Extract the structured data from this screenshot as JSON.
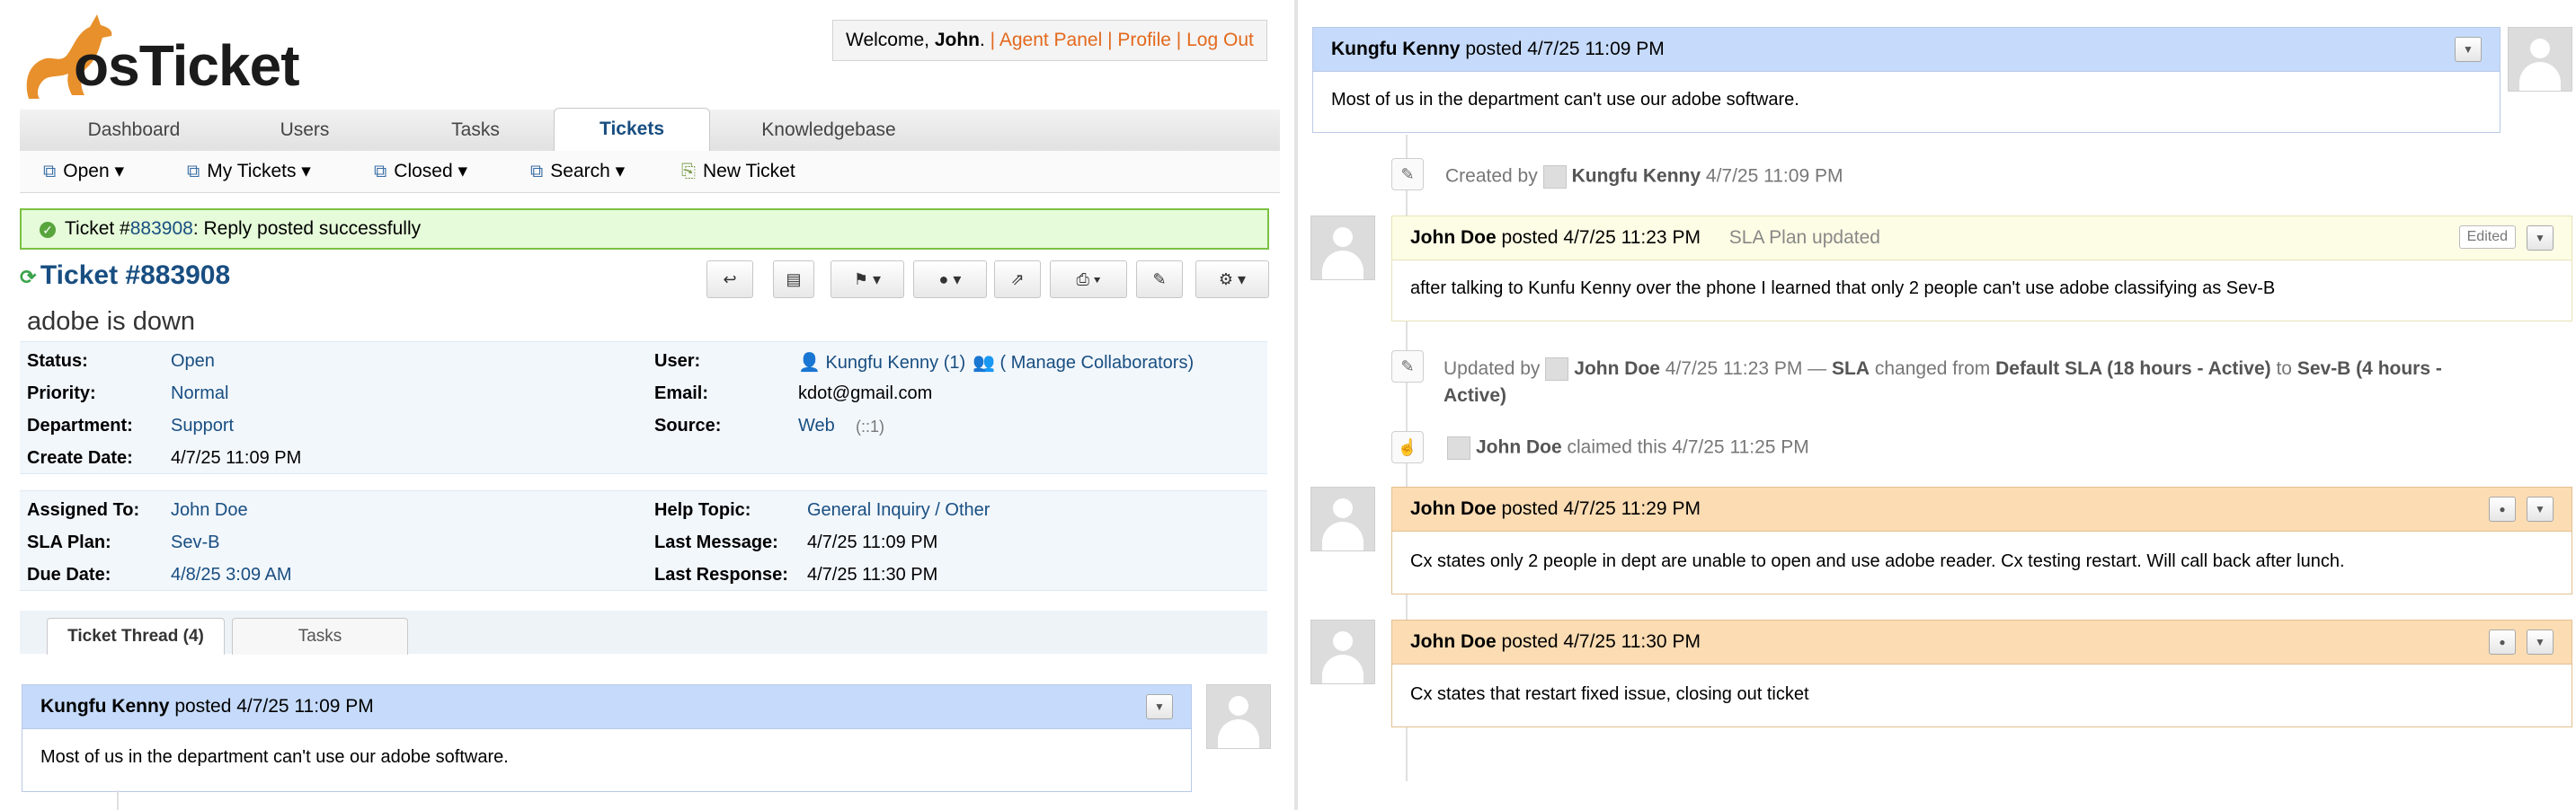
{
  "header": {
    "logo_text": "osTicket",
    "welcome_prefix": "Welcome, ",
    "welcome_name": "John",
    "welcome_suffix": ".",
    "agent_panel": "Agent Panel",
    "profile": "Profile",
    "logout": "Log Out",
    "sep": "|"
  },
  "nav": {
    "tabs": [
      "Dashboard",
      "Users",
      "Tasks",
      "Tickets",
      "Knowledgebase"
    ],
    "active_tab": "Tickets",
    "subnav": [
      "Open",
      "My Tickets",
      "Closed",
      "Search",
      "New Ticket"
    ]
  },
  "notice": {
    "prefix": "Ticket #",
    "number": "883908",
    "suffix": ": Reply posted successfully"
  },
  "ticket": {
    "title": "Ticket #883908",
    "subject": "adobe is down",
    "left_fields": [
      {
        "label": "Status:",
        "value": "Open"
      },
      {
        "label": "Priority:",
        "value": "Normal"
      },
      {
        "label": "Department:",
        "value": "Support"
      },
      {
        "label": "Create Date:",
        "value": "4/7/25 11:09 PM"
      }
    ],
    "right_fields": {
      "user_label": "User:",
      "user_name": "Kungfu Kenny",
      "user_count": "(1)",
      "manage": "( Manage Collaborators)",
      "email_label": "Email:",
      "email_value": "kdot@gmail.com",
      "source_label": "Source:",
      "source_value": "Web",
      "source_ip": "(::1)"
    },
    "left_fields2": [
      {
        "label": "Assigned To:",
        "value": "John Doe"
      },
      {
        "label": "SLA Plan:",
        "value": "Sev-B"
      },
      {
        "label": "Due Date:",
        "value": "4/8/25 3:09 AM"
      }
    ],
    "right_fields2": [
      {
        "label": "Help Topic:",
        "value": "General Inquiry / Other"
      },
      {
        "label": "Last Message:",
        "value": "4/7/25 11:09 PM"
      },
      {
        "label": "Last Response:",
        "value": "4/7/25 11:30 PM"
      }
    ]
  },
  "thread_tabs": [
    "Ticket Thread (4)",
    "Tasks"
  ],
  "left_entry": {
    "author": "Kungfu Kenny",
    "posted": "posted 4/7/25 11:09 PM",
    "body": "Most of us in the department can't use our adobe software."
  },
  "right_thread": {
    "entry1": {
      "author": "Kungfu Kenny",
      "posted": "posted 4/7/25 11:09 PM",
      "body": "Most of us in the department can't use our adobe software."
    },
    "event_created": {
      "prefix": "Created by",
      "user": "Kungfu Kenny",
      "time": "4/7/25 11:09 PM"
    },
    "entry2": {
      "author": "John Doe",
      "posted": "posted 4/7/25 11:23 PM",
      "note": "SLA Plan updated",
      "edited": "Edited",
      "body": "after talking to Kunfu Kenny over the phone I learned that only 2 people can't use adobe classifying as Sev-B"
    },
    "event_updated": {
      "prefix": "Updated by",
      "user": "John Doe",
      "time": "4/7/25 11:23 PM —",
      "sla": "SLA",
      "changed_from": "changed from",
      "old": "Default SLA (18 hours - Active)",
      "to": "to",
      "new_line1": "Sev-B (4 hours -",
      "new_line2": "Active)"
    },
    "event_claimed": {
      "user": "John Doe",
      "text": "claimed this 4/7/25 11:25 PM"
    },
    "entry3": {
      "author": "John Doe",
      "posted": "posted 4/7/25 11:29 PM",
      "body": "Cx states only 2 people in dept are unable to open and use adobe reader. Cx testing restart. Will call back after lunch."
    },
    "entry4": {
      "author": "John Doe",
      "posted": "posted 4/7/25 11:30 PM",
      "body": "Cx states that restart fixed issue, closing out ticket"
    }
  },
  "colors": {
    "link": "#184e81",
    "accent_orange": "#e3691d",
    "success_bg": "#e5fbd9",
    "message_head": "#c6dbfb",
    "response_head": "#fbdcb3",
    "note_head": "#fdfde5"
  }
}
